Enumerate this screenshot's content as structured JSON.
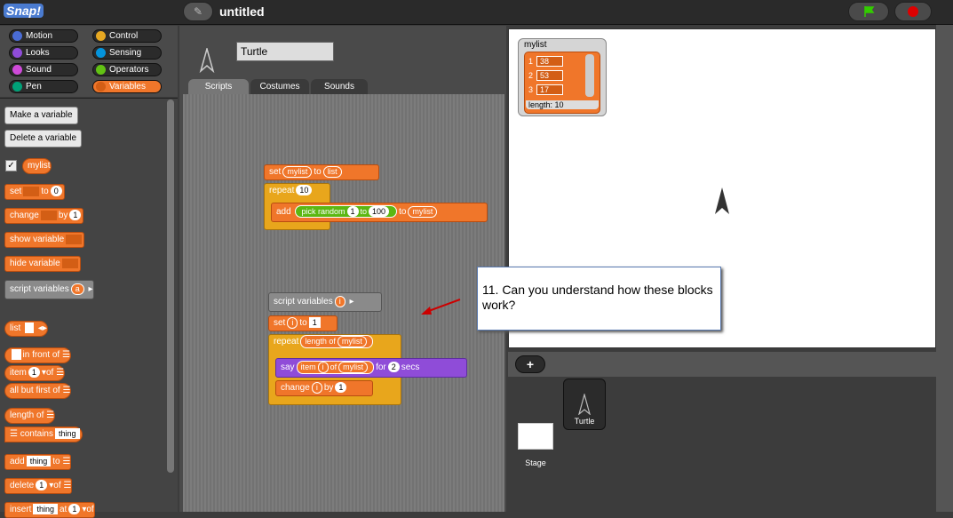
{
  "app": {
    "logo": "Snap!",
    "project_title": "untitled"
  },
  "categories": [
    {
      "label": "Motion",
      "color": "#4a6cd4"
    },
    {
      "label": "Control",
      "color": "#e6a822"
    },
    {
      "label": "Looks",
      "color": "#8f4cd8"
    },
    {
      "label": "Sensing",
      "color": "#0494dc"
    },
    {
      "label": "Sound",
      "color": "#cf4ad9"
    },
    {
      "label": "Operators",
      "color": "#62c213"
    },
    {
      "label": "Pen",
      "color": "#00a178"
    },
    {
      "label": "Variables",
      "color": "#f0762a",
      "selected": true
    }
  ],
  "palette": {
    "make_var": "Make a variable",
    "delete_var": "Delete a variable",
    "var_name": "mylist",
    "set": "set",
    "to": "to",
    "set_val": "0",
    "change": "change",
    "by": "by",
    "change_val": "1",
    "show_var": "show variable",
    "hide_var": "hide variable",
    "script_vars": "script variables",
    "script_var_a": "a",
    "list": "list",
    "in_front_of": "in front of",
    "item": "item",
    "item_val": "1",
    "of": "of",
    "all_but_first": "all but first of",
    "length_of": "length of",
    "contains": "contains",
    "contains_thing": "thing",
    "add": "add",
    "add_thing": "thing",
    "delete": "delete",
    "delete_val": "1",
    "insert": "insert",
    "insert_thing": "thing",
    "at": "at",
    "insert_val": "1"
  },
  "sprite": {
    "name": "Turtle"
  },
  "tabs": [
    "Scripts",
    "Costumes",
    "Sounds"
  ],
  "script1": {
    "set": "set",
    "var": "mylist",
    "to": "to",
    "list": "list",
    "repeat": "repeat",
    "times": "10",
    "add": "add",
    "pick_random": "pick random",
    "from": "1",
    "to2": "to",
    "max": "100",
    "to3": "to",
    "target": "mylist"
  },
  "script2": {
    "script_vars": "script variables",
    "var": "i",
    "set": "set",
    "set_var": "i",
    "to": "to",
    "set_val": "1",
    "repeat": "repeat",
    "length_of": "length of",
    "list": "mylist",
    "say": "say",
    "item": "item",
    "item_var": "i",
    "of": "of",
    "say_list": "mylist",
    "for": "for",
    "secs_val": "2",
    "secs": "secs",
    "change": "change",
    "change_var": "i",
    "by": "by",
    "change_val": "1"
  },
  "watcher": {
    "title": "mylist",
    "rows": [
      {
        "idx": "1",
        "val": "38"
      },
      {
        "idx": "2",
        "val": "53"
      },
      {
        "idx": "3",
        "val": "17"
      }
    ],
    "length_label": "length: 10"
  },
  "callout": {
    "text": "11.  Can you understand how these blocks work?"
  },
  "corral": {
    "stage_label": "Stage",
    "sprite_label": "Turtle"
  }
}
